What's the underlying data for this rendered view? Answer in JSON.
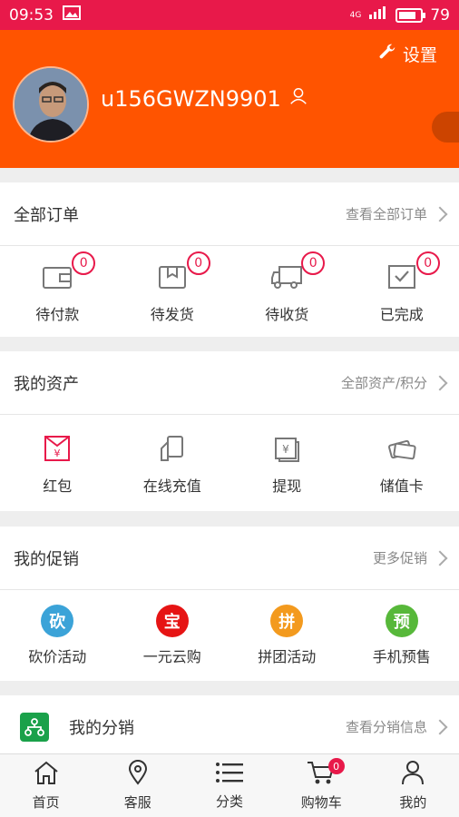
{
  "status_bar": {
    "time": "09:53",
    "network": "4G",
    "battery": "79",
    "battery_level": 0.79
  },
  "header": {
    "settings_label": "设置",
    "username": "u156GWZN9901"
  },
  "orders": {
    "title": "全部订单",
    "more": "查看全部订单",
    "items": [
      {
        "label": "待付款",
        "count": "0"
      },
      {
        "label": "待发货",
        "count": "0"
      },
      {
        "label": "待收货",
        "count": "0"
      },
      {
        "label": "已完成",
        "count": "0"
      }
    ]
  },
  "assets": {
    "title": "我的资产",
    "more": "全部资产/积分",
    "items": [
      {
        "label": "红包"
      },
      {
        "label": "在线充值"
      },
      {
        "label": "提现"
      },
      {
        "label": "储值卡"
      }
    ]
  },
  "promotions": {
    "title": "我的促销",
    "more": "更多促销",
    "items": [
      {
        "label": "砍价活动",
        "icon_text": "砍",
        "color": "#3ba3d8"
      },
      {
        "label": "一元云购",
        "icon_text": "宝",
        "color": "#e61414"
      },
      {
        "label": "拼团活动",
        "icon_text": "拼",
        "color": "#f39a1e"
      },
      {
        "label": "手机预售",
        "icon_text": "预",
        "color": "#57b83a"
      }
    ]
  },
  "distribution": {
    "title": "我的分销",
    "more": "查看分销信息"
  },
  "bottom_nav": [
    {
      "label": "首页"
    },
    {
      "label": "客服"
    },
    {
      "label": "分类"
    },
    {
      "label": "购物车",
      "badge": "0"
    },
    {
      "label": "我的"
    }
  ],
  "colors": {
    "brand_orange": "#ff5400",
    "status_red": "#e8194a"
  }
}
